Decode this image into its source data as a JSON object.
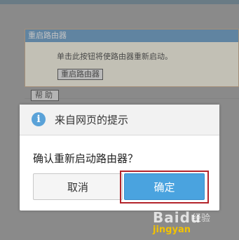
{
  "background_page": {
    "panel_title": "重启路由器",
    "description": "单击此按钮将使路由器重新启动。",
    "reboot_button_label": "重启路由器",
    "help_button_label": "帮助"
  },
  "dialog": {
    "title": "来自网页的提示",
    "message": "确认重新启动路由器？",
    "cancel_label": "取消",
    "ok_label": "确定",
    "icon": "info-icon"
  },
  "watermark": {
    "brand": "Baidu",
    "sub": "经验",
    "site": "jingyan"
  },
  "colors": {
    "panel_title_bg": "#4e8fc4",
    "ok_button_bg": "#4aa3df",
    "highlight_frame": "#b3242b",
    "info_icon": "#5aa2d8"
  }
}
